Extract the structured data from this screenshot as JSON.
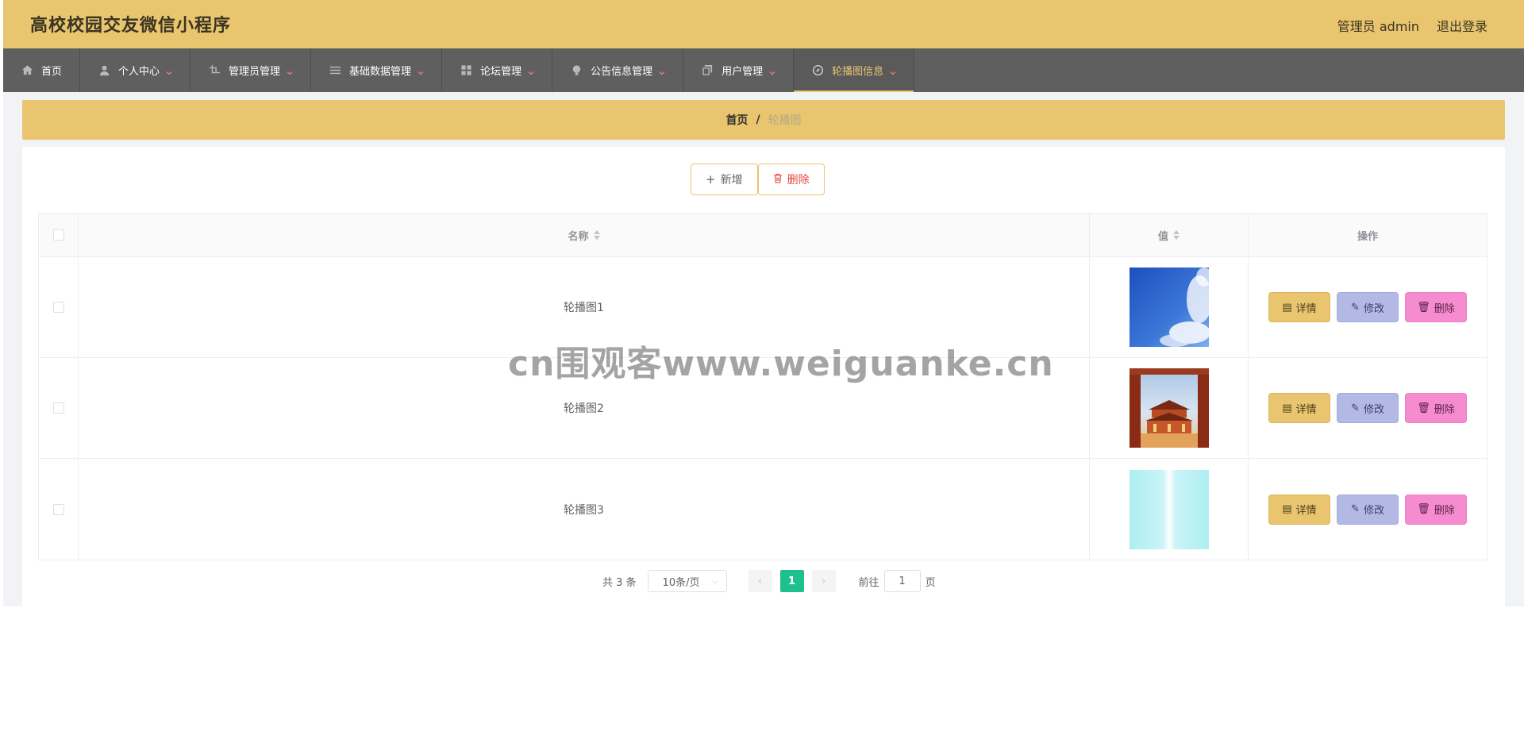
{
  "header": {
    "title": "高校校园交友微信小程序",
    "user": "管理员 admin",
    "logout": "退出登录"
  },
  "nav": [
    {
      "label": "首页",
      "icon": "home-icon",
      "arrow": false
    },
    {
      "label": "个人中心",
      "icon": "user-icon",
      "arrow": true
    },
    {
      "label": "管理员管理",
      "icon": "crop-icon",
      "arrow": true
    },
    {
      "label": "基础数据管理",
      "icon": "menu-icon",
      "arrow": true
    },
    {
      "label": "论坛管理",
      "icon": "grid-icon",
      "arrow": true
    },
    {
      "label": "公告信息管理",
      "icon": "bulb-icon",
      "arrow": true
    },
    {
      "label": "用户管理",
      "icon": "copy-icon",
      "arrow": true
    },
    {
      "label": "轮播图信息",
      "icon": "compass-icon",
      "arrow": true,
      "active": true
    }
  ],
  "breadcrumb": {
    "home": "首页",
    "separator": "/",
    "current": "轮播图"
  },
  "toolbar": {
    "add_label": "新增",
    "delete_label": "删除"
  },
  "table": {
    "headers": {
      "name": "名称",
      "value": "值",
      "ops": "操作"
    },
    "rows": [
      {
        "name": "轮播图1",
        "thumb": "sky-clouds"
      },
      {
        "name": "轮播图2",
        "thumb": "palace"
      },
      {
        "name": "轮播图3",
        "thumb": "light-cyan"
      }
    ],
    "actions": {
      "detail": "详情",
      "edit": "修改",
      "delete": "删除"
    }
  },
  "pagination": {
    "total": "共 3 条",
    "page_size": "10条/页",
    "current_page": "1",
    "goto_label": "前往",
    "goto_value": "1",
    "page_unit": "页"
  },
  "watermark": "cn围观客www.weiguanke.cn",
  "colors": {
    "accent": "#e8c56e",
    "nav_bg": "#5f5f5f",
    "pager_active": "#1ec08e",
    "detail_btn": "#e8c56e",
    "edit_btn": "#b2b9e5",
    "delete_btn": "#f58cd0"
  }
}
